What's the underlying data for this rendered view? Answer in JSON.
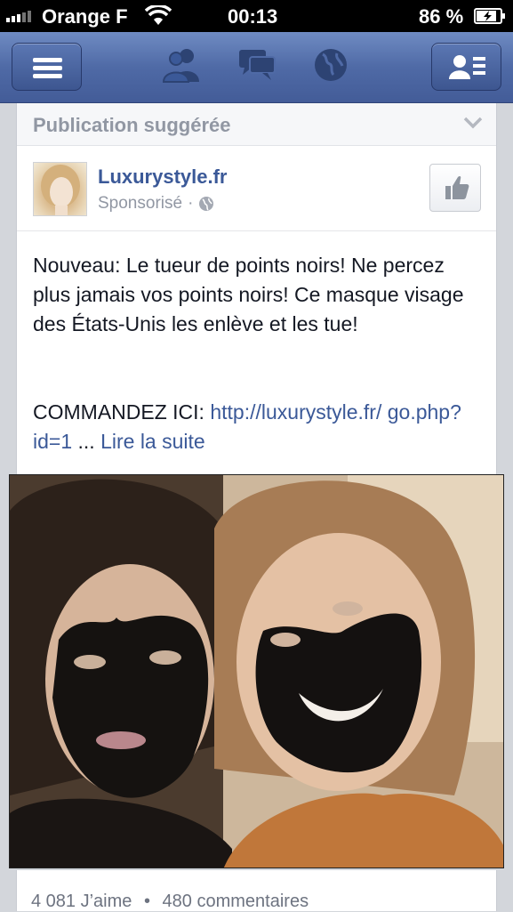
{
  "status_bar": {
    "carrier": "Orange F",
    "time": "00:13",
    "battery": "86 %"
  },
  "nav": {
    "left_icon": "menu-icon",
    "center_icons": [
      "friends-icon",
      "messages-icon",
      "globe-icon"
    ],
    "right_icon": "contacts-icon",
    "color": "#4f6aa6"
  },
  "suggested": {
    "header": "Publication suggérée"
  },
  "post": {
    "page_name": "Luxurystyle.fr",
    "sponsored": "Sponsorisé",
    "text": "Nouveau: Le tueur de points noirs! Ne percez plus jamais vos points noirs! Ce masque visage des États-Unis les enlève et les tue!",
    "cta_prefix": "COMMANDEZ ICI: ",
    "cta_link": "http://luxurystyle.fr/ go.php?id=1",
    "ellipsis": " ... ",
    "read_more": "Lire la suite",
    "likes": "4 081 J’aime",
    "separator": "•",
    "comments": "480 commentaires"
  }
}
